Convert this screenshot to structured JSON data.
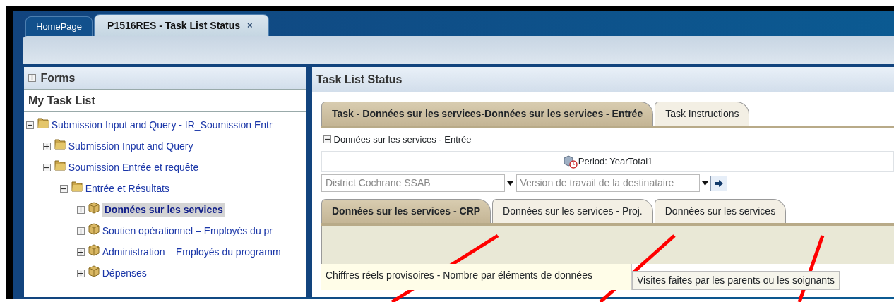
{
  "app_tabs": [
    {
      "label": "HomePage",
      "selected": false,
      "closable": false
    },
    {
      "label": "P1516RES - Task List Status",
      "selected": true,
      "closable": true,
      "close": "×"
    }
  ],
  "left_panel": {
    "forms_header": {
      "label": "Forms",
      "expanded": false
    },
    "task_list_title": "My Task List",
    "tree": [
      {
        "label": "Submission Input and Query - IR_Soumission Entr",
        "kind": "folder",
        "expanded": true,
        "selected": false,
        "children": [
          {
            "label": "Submission Input and Query",
            "kind": "folder",
            "expanded": false,
            "selected": false
          },
          {
            "label": "Soumission Entrée et requête",
            "kind": "folder",
            "expanded": true,
            "selected": false,
            "children": [
              {
                "label": "Entrée et Résultats",
                "kind": "folder",
                "expanded": true,
                "selected": false,
                "children": [
                  {
                    "label": "Données sur les services",
                    "kind": "task",
                    "expanded": false,
                    "selected": true
                  },
                  {
                    "label": "Soutien opérationnel – Employés du pr",
                    "kind": "task",
                    "expanded": false,
                    "selected": false
                  },
                  {
                    "label": "Administration – Employés du programm",
                    "kind": "task",
                    "expanded": false,
                    "selected": false
                  },
                  {
                    "label": "Dépenses",
                    "kind": "task",
                    "expanded": false,
                    "selected": false
                  }
                ]
              }
            ]
          }
        ]
      }
    ]
  },
  "main_panel": {
    "title": "Task List Status",
    "task_tabs": [
      {
        "label": "Task - Données sur les services-Données sur les services - Entrée",
        "selected": true
      },
      {
        "label": "Task Instructions",
        "selected": false
      }
    ],
    "section": {
      "label": "Données sur les services - Entrée",
      "expanded": true
    },
    "period": "Period: YearTotal1",
    "selectors": [
      {
        "value": "District Cochrane SSAB"
      },
      {
        "value": "Version de travail de la destinataire"
      }
    ],
    "form_tabs": [
      {
        "label": "Données sur les services - CRP",
        "selected": true
      },
      {
        "label": "Données sur les services - Proj.",
        "selected": false
      },
      {
        "label": "Données sur les services",
        "selected": false
      }
    ],
    "grid": {
      "row_header": "Chiffres réels provisoires - Nombre par éléments de données",
      "column_header": "Visites faites par les parents ou les soignants"
    }
  }
}
